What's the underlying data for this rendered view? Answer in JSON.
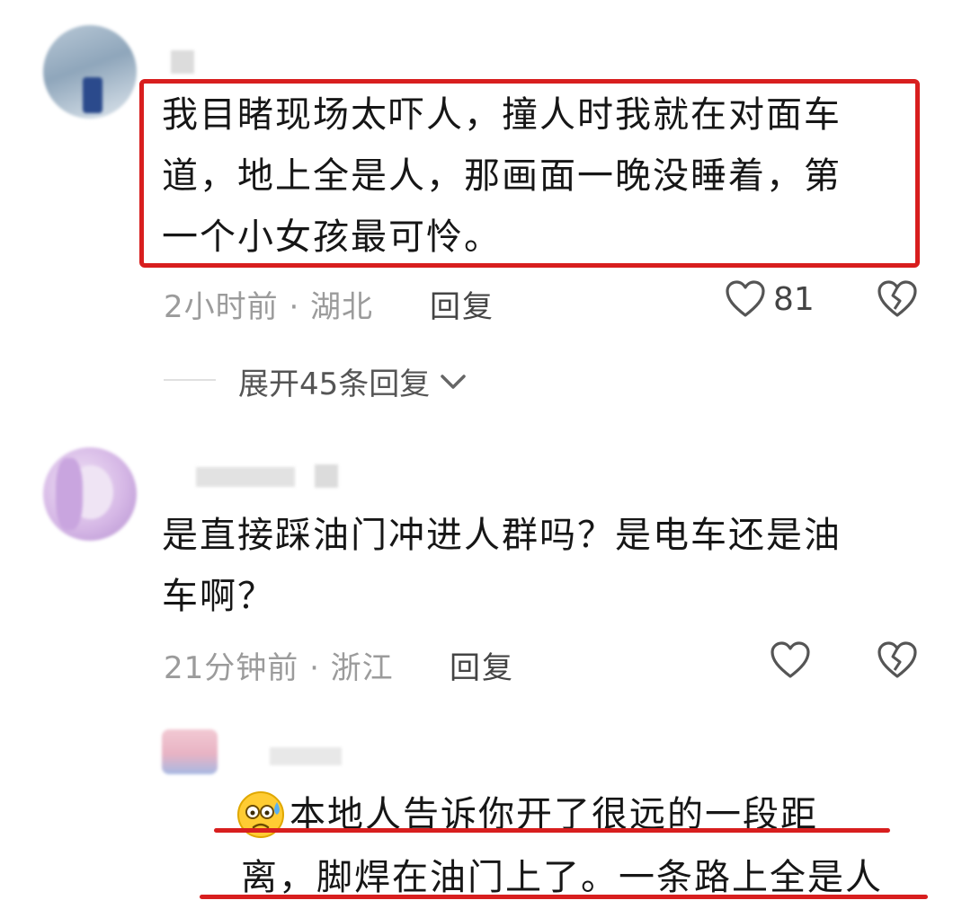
{
  "comments": [
    {
      "text_lines": [
        "我目睹现场太吓人，撞人时我就在对面车",
        "道，地上全是人，那画面一晚没睡着，第",
        "一个小女孩最可怜。"
      ],
      "time": "2小时前 · 湖北",
      "reply_label": "回复",
      "like_count": "81",
      "expand_replies_label": "展开45条回复"
    },
    {
      "text_lines": [
        "是直接踩油门冲进人群吗？是电车还是油",
        "车啊？"
      ],
      "time": "21分钟前 · 浙江",
      "reply_label": "回复",
      "like_count": ""
    },
    {
      "emoji": "😰",
      "text_lines": [
        "本地人告诉你开了很远的一段距",
        "离，脚焊在油门上了。一条路上全是人"
      ]
    }
  ],
  "icons": {
    "like": "heart-outline-icon",
    "dislike": "broken-heart-icon",
    "expand": "chevron-down-icon"
  },
  "colors": {
    "highlight": "#d81e1e",
    "meta_text": "#9b9b9b"
  }
}
